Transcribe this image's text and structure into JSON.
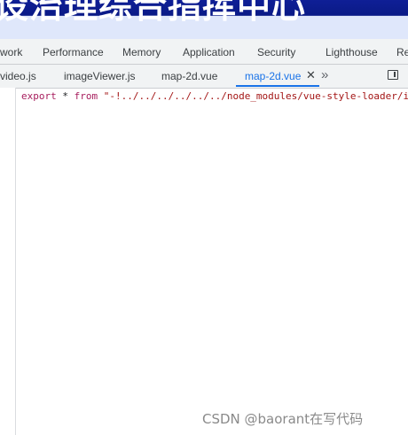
{
  "banner": {
    "text": "设治理综合指挥中心"
  },
  "panel_tabs": [
    "work",
    "Performance",
    "Memory",
    "Application",
    "Security",
    "Lighthouse",
    "Re"
  ],
  "file_tabs": {
    "items": [
      "video.js",
      "imageViewer.js",
      "map-2d.vue",
      "map-2d.vue"
    ],
    "active_index": 3,
    "close_glyph": "✕",
    "more_glyph": "»"
  },
  "editor": {
    "keyword_export": "export",
    "op_star": " * ",
    "keyword_from": "from",
    "string": " \"-!../../../../../../node_modules/vue-style-loader/i"
  },
  "watermark": "CSDN @baorant在写代码",
  "colors": {
    "accent": "#1a73e8",
    "keyword": "#a71d5d",
    "string": "#a31515"
  }
}
